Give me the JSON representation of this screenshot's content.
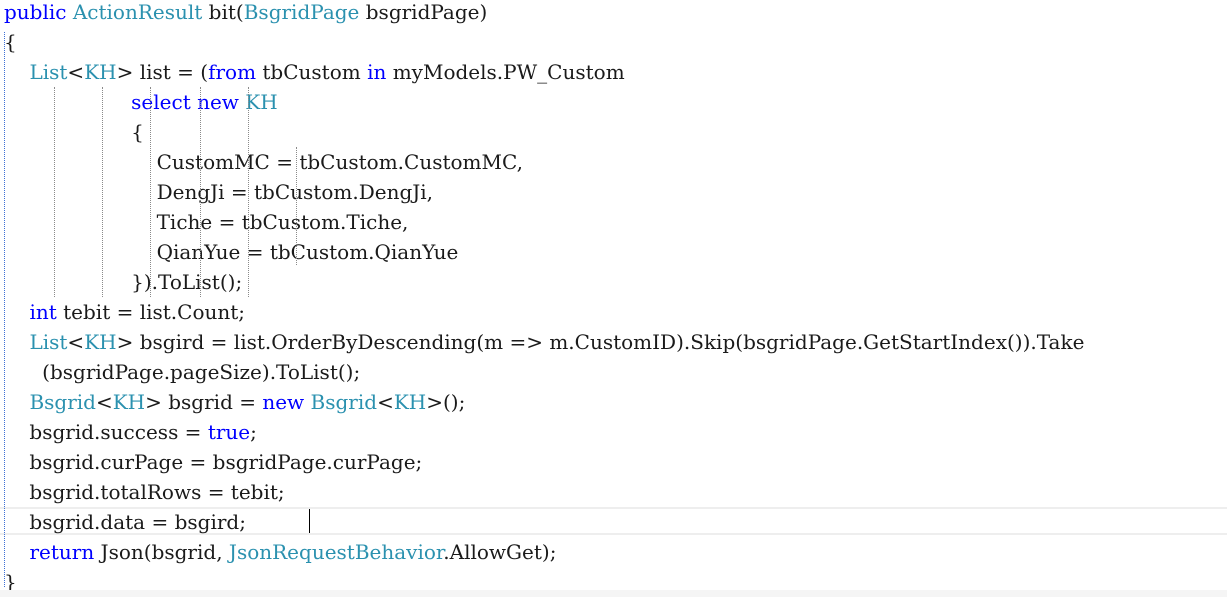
{
  "editor": {
    "lines": [
      [
        [
          "kw",
          "public"
        ],
        [
          "tx",
          " "
        ],
        [
          "ty",
          "ActionResult"
        ],
        [
          "tx",
          " bit("
        ],
        [
          "ty",
          "BsgridPage"
        ],
        [
          "tx",
          " bsgridPage)"
        ]
      ],
      [
        [
          "tx",
          "{"
        ]
      ],
      [
        [
          "tx",
          "    "
        ],
        [
          "ty",
          "List"
        ],
        [
          "tx",
          "<"
        ],
        [
          "ty",
          "KH"
        ],
        [
          "tx",
          "> list = ("
        ],
        [
          "kw",
          "from"
        ],
        [
          "tx",
          " tbCustom "
        ],
        [
          "kw",
          "in"
        ],
        [
          "tx",
          " myModels.PW_Custom"
        ]
      ],
      [
        [
          "tx",
          "                    "
        ],
        [
          "kw",
          "select"
        ],
        [
          "tx",
          " "
        ],
        [
          "kw",
          "new"
        ],
        [
          "tx",
          " "
        ],
        [
          "ty",
          "KH"
        ]
      ],
      [
        [
          "tx",
          "                    {"
        ]
      ],
      [
        [
          "tx",
          "                        CustomMC = tbCustom.CustomMC,"
        ]
      ],
      [
        [
          "tx",
          "                        DengJi = tbCustom.DengJi,"
        ]
      ],
      [
        [
          "tx",
          "                        Tiche = tbCustom.Tiche,"
        ]
      ],
      [
        [
          "tx",
          "                        QianYue = tbCustom.QianYue"
        ]
      ],
      [
        [
          "tx",
          "                    }).ToList();"
        ]
      ],
      [
        [
          "tx",
          "    "
        ],
        [
          "kw",
          "int"
        ],
        [
          "tx",
          " tebit = list.Count;"
        ]
      ],
      [
        [
          "tx",
          "    "
        ],
        [
          "ty",
          "List"
        ],
        [
          "tx",
          "<"
        ],
        [
          "ty",
          "KH"
        ],
        [
          "tx",
          "> bsgird = list.OrderByDescending(m => m.CustomID).Skip(bsgridPage.GetStartIndex()).Take"
        ]
      ],
      [
        [
          "tx",
          "      (bsgridPage.pageSize).ToList();"
        ]
      ],
      [
        [
          "tx",
          "    "
        ],
        [
          "ty",
          "Bsgrid"
        ],
        [
          "tx",
          "<"
        ],
        [
          "ty",
          "KH"
        ],
        [
          "tx",
          "> bsgrid = "
        ],
        [
          "kw",
          "new"
        ],
        [
          "tx",
          " "
        ],
        [
          "ty",
          "Bsgrid"
        ],
        [
          "tx",
          "<"
        ],
        [
          "ty",
          "KH"
        ],
        [
          "tx",
          ">();"
        ]
      ],
      [
        [
          "tx",
          "    bsgrid.success = "
        ],
        [
          "kw",
          "true"
        ],
        [
          "tx",
          ";"
        ]
      ],
      [
        [
          "tx",
          "    bsgrid.curPage = bsgridPage.curPage;"
        ]
      ],
      [
        [
          "tx",
          "    bsgrid.totalRows = tebit;"
        ]
      ],
      [
        [
          "tx",
          "    bsgrid.data = bsgird;"
        ]
      ],
      [
        [
          "tx",
          "    "
        ],
        [
          "kw",
          "return"
        ],
        [
          "tx",
          " Json(bsgrid, "
        ],
        [
          "ty",
          "JsonRequestBehavior"
        ],
        [
          "tx",
          ".AllowGet);"
        ]
      ],
      [
        [
          "tx",
          "}"
        ]
      ]
    ],
    "colors": {
      "keyword": "#0000ff",
      "type": "#2b91af",
      "text": "#1a1a1a",
      "current_line_border": "#eeeeee",
      "guide": "#8a8a8a",
      "guide_outer": "#3d6fd6"
    }
  }
}
